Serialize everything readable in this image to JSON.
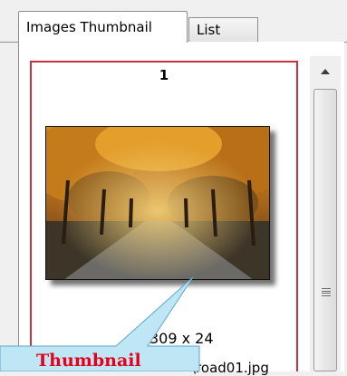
{
  "tabs": [
    {
      "label": "Images Thumbnail",
      "active": true
    },
    {
      "label": "List",
      "active": false
    }
  ],
  "thumbnail": {
    "index": "1",
    "dimensions": "309 x 24",
    "filename": "\\road01.jpg",
    "image_description_icon": "autumn-road-photo"
  },
  "callout": {
    "text": "Thumbnail",
    "color": "#e8001a"
  },
  "colors": {
    "selection_border": "#c8323c",
    "callout_fill": "#bfe6f5"
  }
}
